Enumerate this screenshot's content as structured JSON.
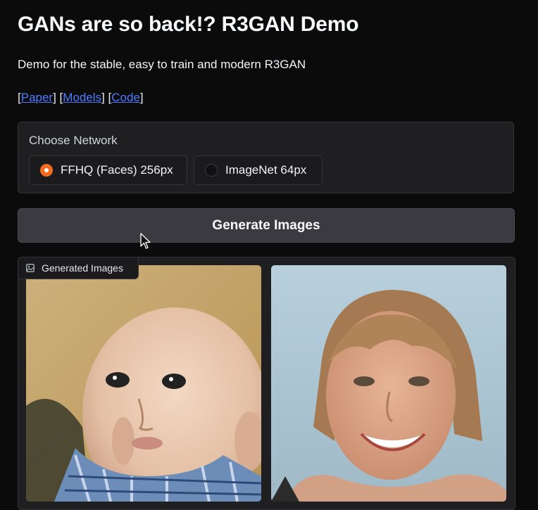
{
  "header": {
    "title": "GANs are so back!? R3GAN Demo",
    "description": "Demo for the stable, easy to train and modern R3GAN"
  },
  "links": [
    {
      "label": "Paper"
    },
    {
      "label": "Models"
    },
    {
      "label": "Code"
    }
  ],
  "network": {
    "label": "Choose Network",
    "options": [
      {
        "label": "FFHQ (Faces) 256px",
        "selected": true
      },
      {
        "label": "ImageNet 64px",
        "selected": false
      }
    ]
  },
  "generate_button": {
    "label": "Generate Images"
  },
  "gallery": {
    "label": "Generated Images",
    "images": [
      {
        "subject": "baby-face"
      },
      {
        "subject": "woman-face"
      }
    ]
  },
  "colors": {
    "accent": "#f26b21",
    "link": "#4f7cff",
    "background": "#0b0b0c",
    "panel": "#1f1f22"
  }
}
